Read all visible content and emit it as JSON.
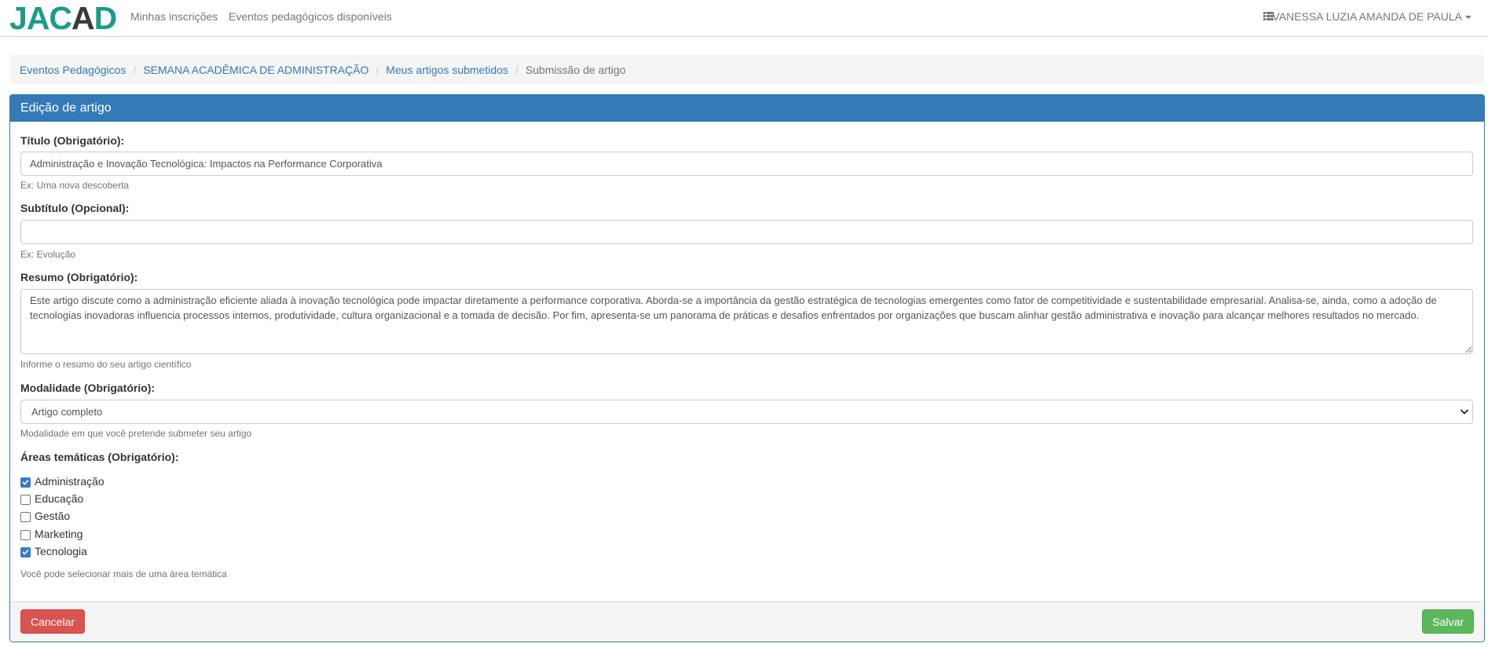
{
  "navbar": {
    "logo": "JACAD",
    "links": [
      "Minhas inscrições",
      "Eventos pedagógicos disponíveis"
    ],
    "list_icon": "list-icon",
    "user_name": "VANESSA LUZIA AMANDA DE PAULA"
  },
  "breadcrumb": {
    "items": [
      "Eventos Pedagógicos",
      "SEMANA ACADÊMICA DE ADMINISTRAÇÃO",
      "Meus artigos submetidos"
    ],
    "active": "Submissão de artigo"
  },
  "panel": {
    "heading": "Edição de artigo",
    "title": {
      "label": "Título (Obrigatório):",
      "value": "Administração e Inovação Tecnológica: Impactos na Performance Corporativa",
      "help": "Ex: Uma nova descoberta"
    },
    "subtitle": {
      "label": "Subtítulo (Opcional):",
      "value": "",
      "help": "Ex: Evolução"
    },
    "abstract": {
      "label": "Resumo (Obrigatório):",
      "value": "Este artigo discute como a administração eficiente aliada à inovação tecnológica pode impactar diretamente a performance corporativa. Aborda-se a importância da gestão estratégica de tecnologias emergentes como fator de competitividade e sustentabilidade empresarial. Analisa-se, ainda, como a adoção de tecnologias inovadoras influencia processos internos, produtividade, cultura organizacional e a tomada de decisão. Por fim, apresenta-se um panorama de práticas e desafios enfrentados por organizações que buscam alinhar gestão administrativa e inovação para alcançar melhores resultados no mercado.",
      "help": "Informe o resumo do seu artigo científico"
    },
    "modality": {
      "label": "Modalidade (Obrigatório):",
      "selected": "Artigo completo",
      "help": "Modalidade em que você pretende submeter seu artigo"
    },
    "areas": {
      "label": "Áreas temáticas (Obrigatório):",
      "options": [
        {
          "label": "Administração",
          "checked": true
        },
        {
          "label": "Educação",
          "checked": false
        },
        {
          "label": "Gestão",
          "checked": false
        },
        {
          "label": "Marketing",
          "checked": false
        },
        {
          "label": "Tecnologia",
          "checked": true
        }
      ],
      "help": "Você pode selecionar mais de uma área temática"
    },
    "buttons": {
      "cancel": "Cancelar",
      "save": "Salvar"
    }
  },
  "colors": {
    "primary": "#337ab7",
    "logo": "#1a9c8a",
    "danger": "#d9534f",
    "success": "#5cb85c",
    "checkbox_checked": "#3a7ac9"
  }
}
